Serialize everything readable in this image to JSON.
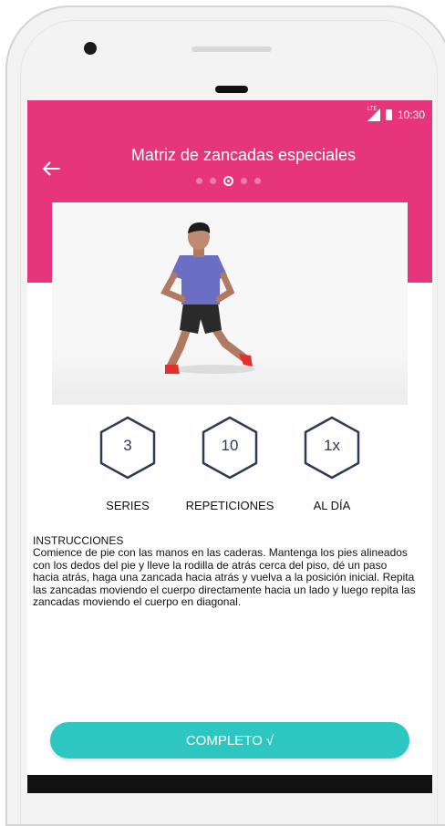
{
  "colors": {
    "accent": "#e6357b",
    "teal": "#2ec6c1",
    "hex_stroke": "#2d3a57"
  },
  "status_bar": {
    "time": "10:30",
    "network": "LTE"
  },
  "header": {
    "title": "Matriz de zancadas especiales",
    "back_icon": "arrow-left-icon",
    "pager": {
      "count": 5,
      "active_index": 2
    }
  },
  "stats": [
    {
      "value": "3",
      "label": "SERIES"
    },
    {
      "value": "10",
      "label": "REPETICIONES"
    },
    {
      "value": "1x",
      "label": "AL DÍA"
    }
  ],
  "instructions": {
    "heading": "INSTRUCCIONES",
    "body": "Comience de pie con las manos en las caderas. Mantenga los pies alineados con los dedos del pie y lleve la rodilla de atrás cerca del piso, dé un paso hacia atrás, haga una zancada hacia atrás y vuelva a la posición inicial. Repita las zancadas moviendo el cuerpo directamente hacia un lado y luego repita las zancadas moviendo el cuerpo en diagonal."
  },
  "complete_button": {
    "label": "COMPLETO √"
  }
}
